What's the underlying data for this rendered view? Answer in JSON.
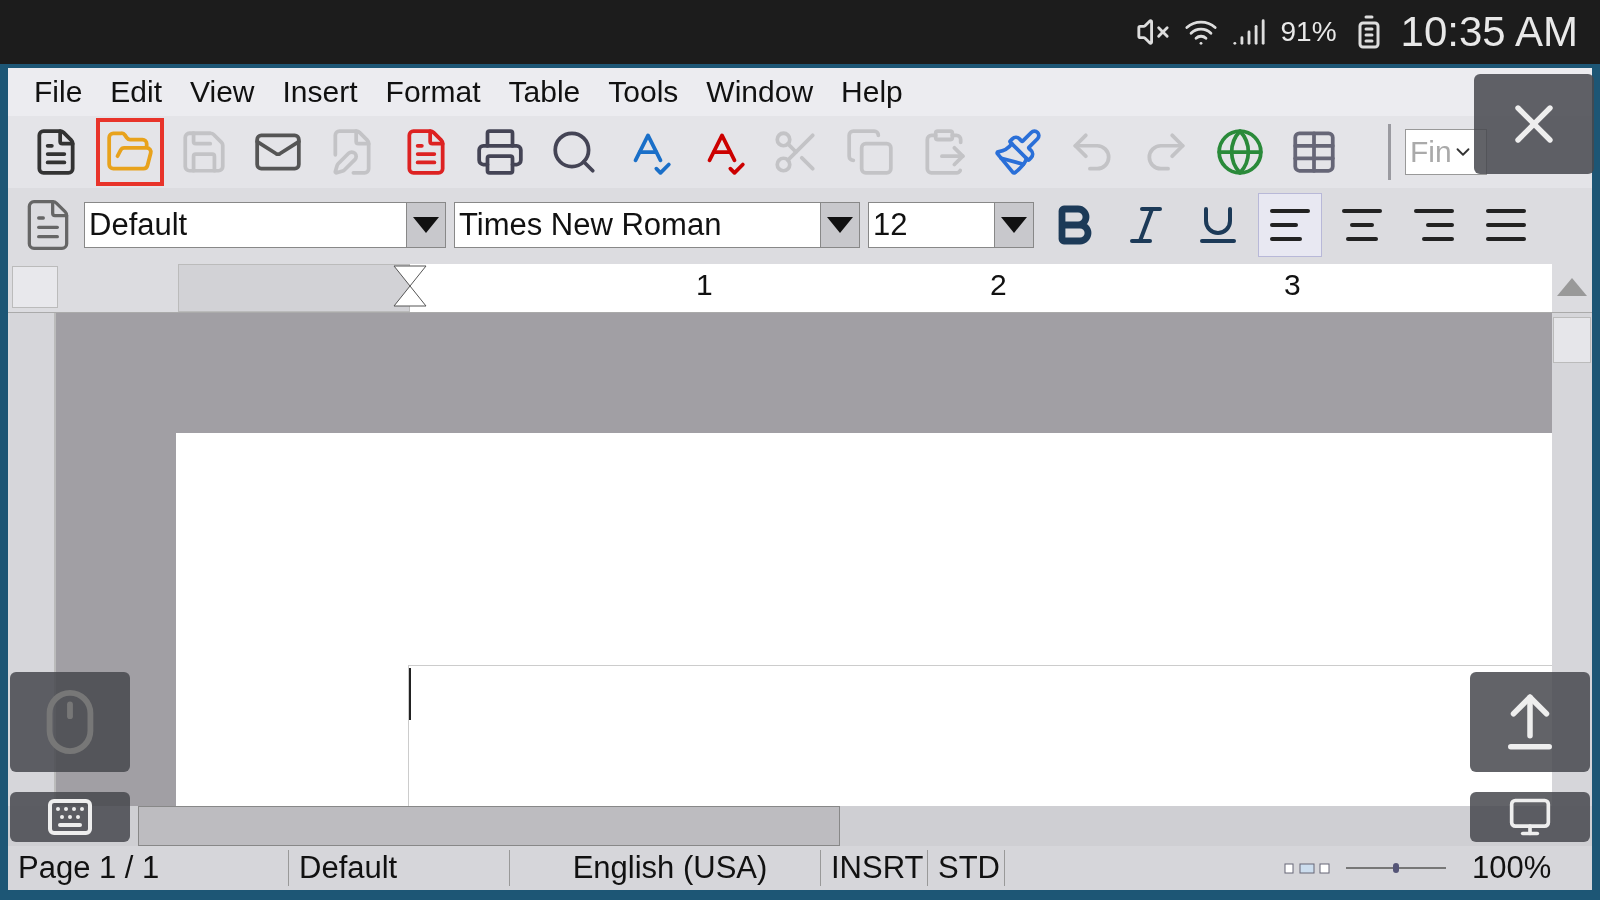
{
  "phone_status": {
    "battery": "91%",
    "time": "10:35 AM"
  },
  "menu": [
    {
      "label": "File"
    },
    {
      "label": "Edit"
    },
    {
      "label": "View"
    },
    {
      "label": "Insert"
    },
    {
      "label": "Format"
    },
    {
      "label": "Table"
    },
    {
      "label": "Tools"
    },
    {
      "label": "Window"
    },
    {
      "label": "Help"
    }
  ],
  "toolbar": [
    {
      "kind": "new",
      "disabled": false,
      "selected": false
    },
    {
      "kind": "open",
      "disabled": false,
      "selected": true
    },
    {
      "kind": "save",
      "disabled": true,
      "selected": false
    },
    {
      "kind": "mail",
      "disabled": false,
      "selected": false
    },
    {
      "kind": "edit",
      "disabled": true,
      "selected": false
    },
    {
      "kind": "pdf",
      "disabled": false,
      "selected": false
    },
    {
      "kind": "print",
      "disabled": false,
      "selected": false
    },
    {
      "kind": "preview",
      "disabled": false,
      "selected": false
    },
    {
      "kind": "spellcheck",
      "disabled": false,
      "selected": false
    },
    {
      "kind": "autospell",
      "disabled": false,
      "selected": false
    },
    {
      "kind": "cut",
      "disabled": true,
      "selected": false
    },
    {
      "kind": "copy",
      "disabled": true,
      "selected": false
    },
    {
      "kind": "paste",
      "disabled": true,
      "selected": false
    },
    {
      "kind": "brush",
      "disabled": false,
      "selected": false
    },
    {
      "kind": "undo",
      "disabled": true,
      "selected": false
    },
    {
      "kind": "redo",
      "disabled": true,
      "selected": false
    },
    {
      "kind": "globe",
      "disabled": false,
      "selected": false
    },
    {
      "kind": "table",
      "disabled": false,
      "selected": false
    }
  ],
  "find_field": {
    "placeholder": "Fin"
  },
  "style_box": {
    "value": "Default"
  },
  "font_box": {
    "value": "Times New Roman"
  },
  "size_box": {
    "value": "12"
  },
  "format_buttons": [
    {
      "kind": "bold",
      "selected": false
    },
    {
      "kind": "italic",
      "selected": false
    },
    {
      "kind": "underline",
      "selected": false
    },
    {
      "kind": "align-left",
      "selected": true
    },
    {
      "kind": "align-center",
      "selected": false
    },
    {
      "kind": "align-right",
      "selected": false
    },
    {
      "kind": "justify",
      "selected": false
    }
  ],
  "ruler": {
    "labels": [
      "1",
      "2",
      "3"
    ]
  },
  "status_bar": {
    "page": "Page 1 / 1",
    "style": "Default",
    "language": "English (USA)",
    "mode": "INSRT",
    "selection": "STD",
    "zoom": {
      "level": 0.5,
      "reading": "100%"
    }
  }
}
